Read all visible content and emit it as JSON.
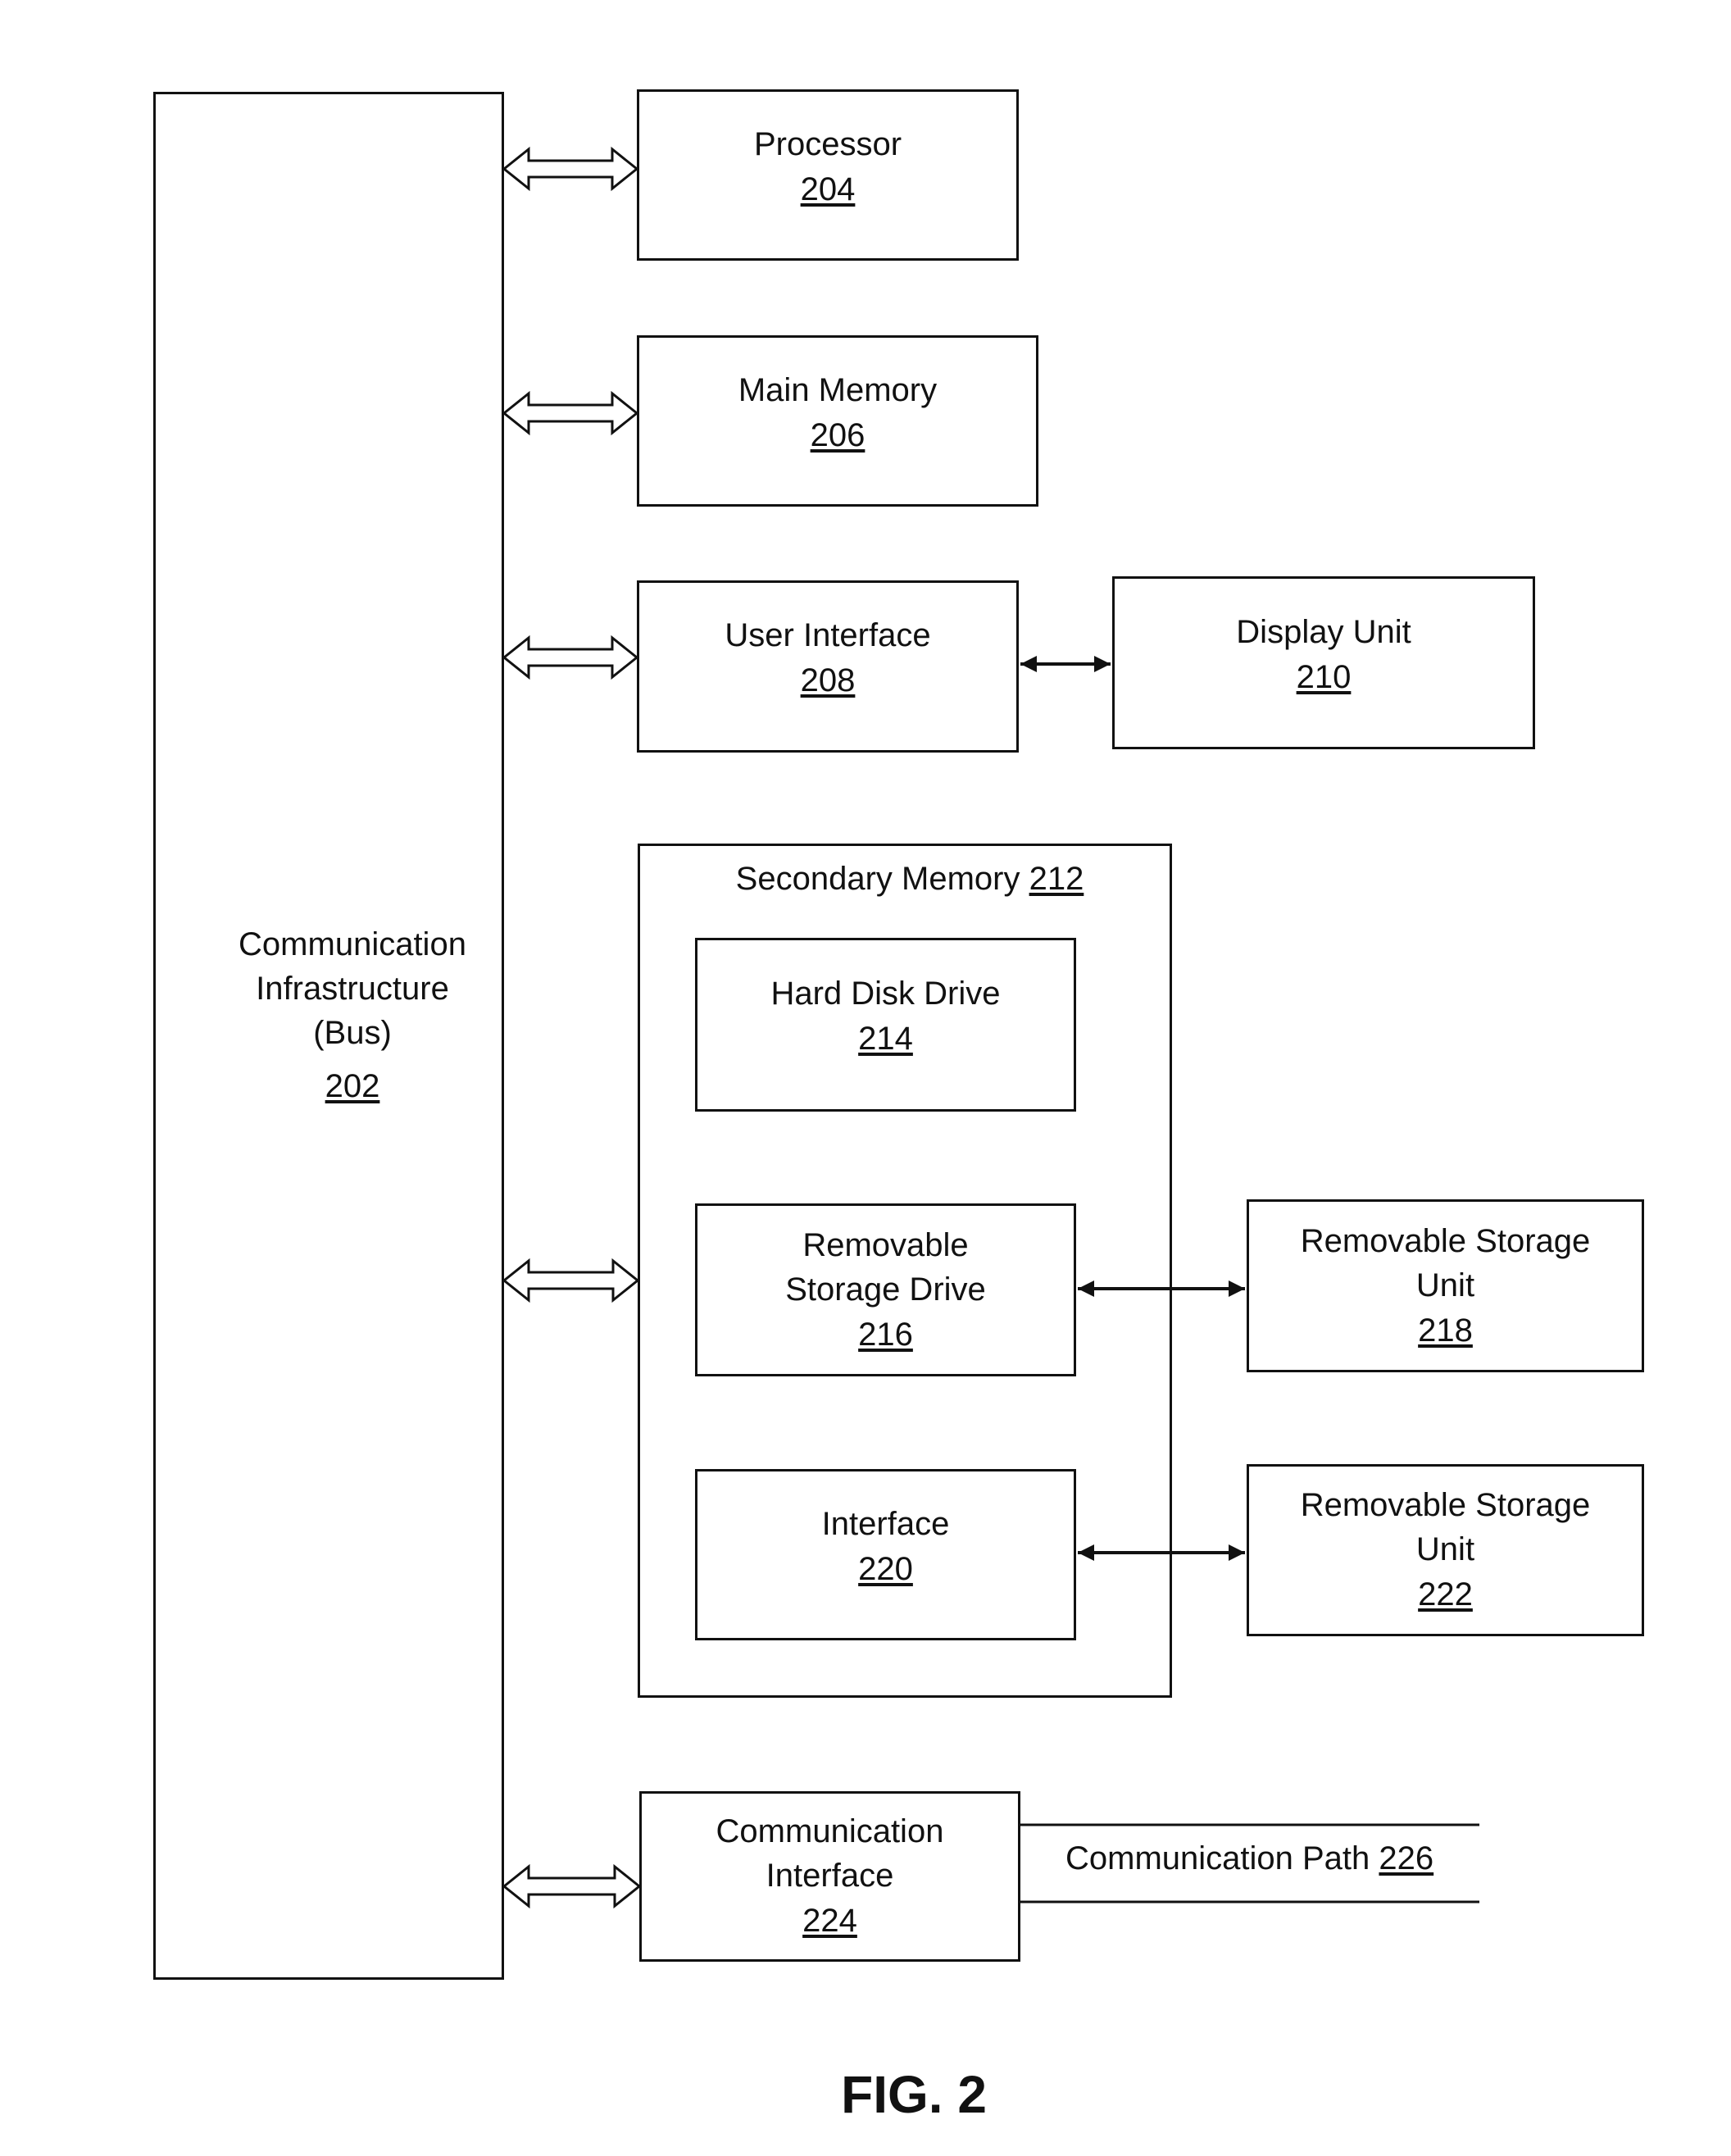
{
  "figure": {
    "caption": "FIG. 2",
    "bus": {
      "lines": [
        "Communication",
        "Infrastructure",
        "(Bus)"
      ],
      "ref": "202"
    },
    "processor": {
      "label": "Processor",
      "ref": "204"
    },
    "main_memory": {
      "label": "Main Memory",
      "ref": "206"
    },
    "user_interface": {
      "label": "User Interface",
      "ref": "208"
    },
    "display_unit": {
      "label": "Display Unit",
      "ref": "210"
    },
    "secondary_memory": {
      "label": "Secondary Memory",
      "ref": "212"
    },
    "hard_disk_drive": {
      "label": "Hard Disk Drive",
      "ref": "214"
    },
    "removable_storage_drive": {
      "lines": [
        "Removable",
        "Storage Drive"
      ],
      "ref": "216"
    },
    "removable_storage_unit_218": {
      "lines": [
        "Removable Storage",
        "Unit"
      ],
      "ref": "218"
    },
    "interface": {
      "label": "Interface",
      "ref": "220"
    },
    "removable_storage_unit_222": {
      "lines": [
        "Removable Storage",
        "Unit"
      ],
      "ref": "222"
    },
    "communication_interface": {
      "lines": [
        "Communication",
        "Interface"
      ],
      "ref": "224"
    },
    "communication_path": {
      "label": "Communication Path",
      "ref": "226"
    }
  }
}
